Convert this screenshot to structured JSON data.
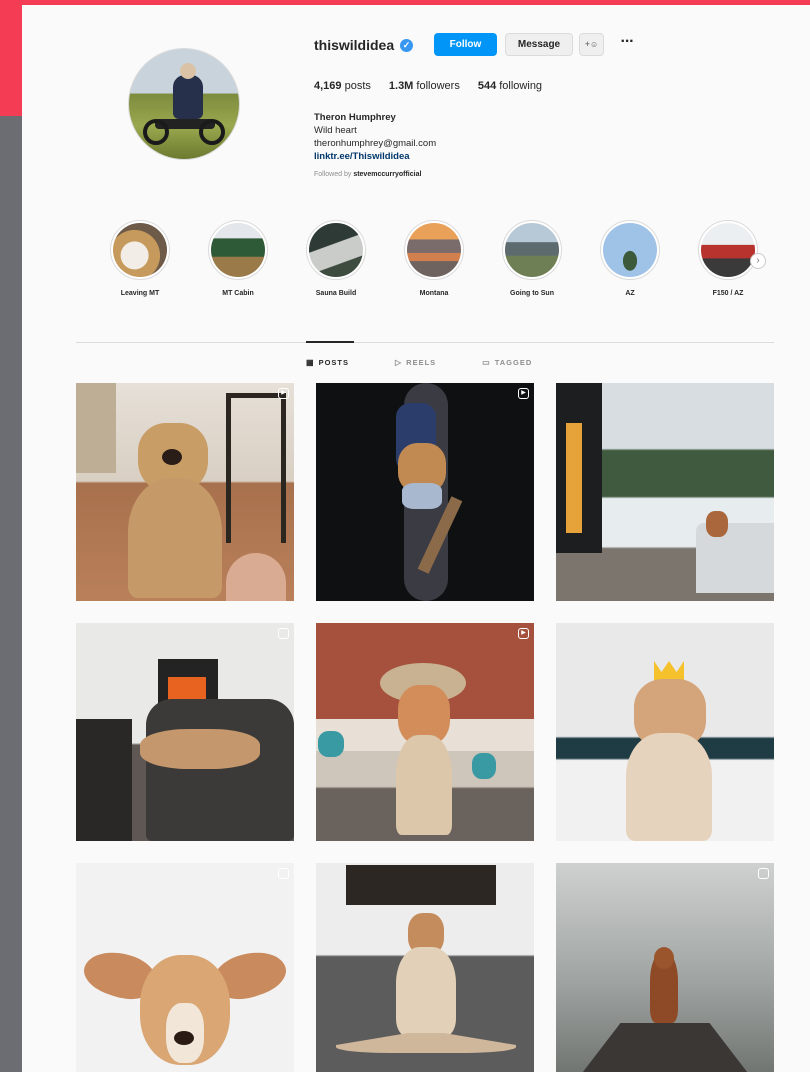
{
  "colors": {
    "accent_red": "#f43d54",
    "accent_gray": "#6b6d72",
    "follow_blue": "#0095f6",
    "link_blue": "#00376b"
  },
  "profile": {
    "username": "thiswildidea",
    "verified_icon": "check-badge-icon",
    "follow_label": "Follow",
    "message_label": "Message",
    "suggest_icon": "add-person-icon",
    "more_icon": "more-horizontal-icon",
    "stats": {
      "posts_count": "4,169",
      "posts_label": "posts",
      "followers_count": "1.3M",
      "followers_label": "followers",
      "following_count": "544",
      "following_label": "following"
    },
    "bio": {
      "name": "Theron Humphrey",
      "line1": "Wild heart",
      "email": "theronhumphrey@gmail.com",
      "link": "linktr.ee/Thiswildidea"
    },
    "followed_prefix": "Followed by",
    "followed_by": "stevemccurryofficial"
  },
  "highlights": [
    {
      "label": "Leaving MT"
    },
    {
      "label": "MT Cabin"
    },
    {
      "label": "Sauna Build"
    },
    {
      "label": "Montana"
    },
    {
      "label": "Going to Sun"
    },
    {
      "label": "AZ"
    },
    {
      "label": "F150 / AZ"
    }
  ],
  "tabs": [
    {
      "label": "POSTS",
      "icon": "grid-icon",
      "active": true
    },
    {
      "label": "REELS",
      "icon": "reels-icon",
      "active": false
    },
    {
      "label": "TAGGED",
      "icon": "tagged-icon",
      "active": false
    }
  ]
}
